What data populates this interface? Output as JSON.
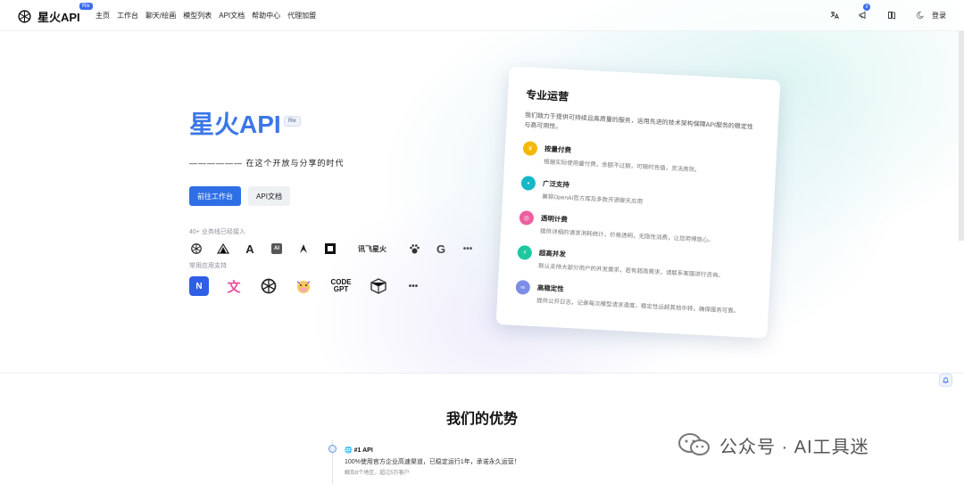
{
  "header": {
    "logo_text": "星火API",
    "logo_badge": "Rix",
    "nav": [
      "主页",
      "工作台",
      "聊天/绘画",
      "模型列表",
      "API文档",
      "帮助中心",
      "代理加盟"
    ],
    "notification_count": "0",
    "login_label": "登录",
    "icons": [
      "translate-icon",
      "megaphone-icon",
      "book-icon",
      "theme-toggle-icon"
    ]
  },
  "hero": {
    "title": "星火API",
    "tag": "Rix",
    "subtitle": "——————  在这个开放与分享的时代",
    "primary_button": "前往工作台",
    "secondary_button": "API文档",
    "business_label": "40+ 业务线已经接入",
    "business_logos": [
      "openai-icon",
      "shark-icon",
      "a-icon",
      "ai-icon",
      "claude-icon",
      "square-icon",
      "讯飞星火",
      "paw-icon",
      "google-icon",
      "more-icon"
    ],
    "apps_label": "常用应用支持",
    "app_logos": [
      "n-icon",
      "translate-app-icon",
      "openai-icon",
      "cow-icon",
      "CODE GPT",
      "box-icon",
      "more-icon"
    ]
  },
  "card": {
    "title": "专业运营",
    "description": "我们致力于提供可持续且高质量的服务，运用先进的技术架构保障API服务的稳定性与高可用性。",
    "features": [
      {
        "title": "按量付费",
        "desc": "根据实际使用量付费，余额不过期，可随时充值，灵活高效。",
        "color": "#f5b800",
        "icon": "coin-icon"
      },
      {
        "title": "广泛支持",
        "desc": "兼容OpenAI官方库及多数开源聊天应用",
        "color": "#14b8c8",
        "icon": "chat-icon"
      },
      {
        "title": "透明计费",
        "desc": "提供详细的请求消耗统计，价格透明，无隐性消费，让您用得放心。",
        "color": "#ec5fa0",
        "icon": "bill-icon"
      },
      {
        "title": "超高并发",
        "desc": "默认支持大部分用户的并发需求，若有超高需求，请联系客服进行咨询。",
        "color": "#1fc7a0",
        "icon": "bolt-icon"
      },
      {
        "title": "高稳定性",
        "desc": "提供公开日志，记录每次模型请求速度，稳定性远超其他中转，确保服务可靠。",
        "color": "#7c8de8",
        "icon": "link-icon"
      }
    ]
  },
  "advantages": {
    "title": "我们的优势",
    "item_title": "🌐 #1 API",
    "item_desc": "100%使用官方企业高速渠道，已稳定运行1年，承诺永久运营！",
    "item_sub": "触及8个地区，超过5万客户"
  },
  "watermark": "公众号 · AI工具迷"
}
